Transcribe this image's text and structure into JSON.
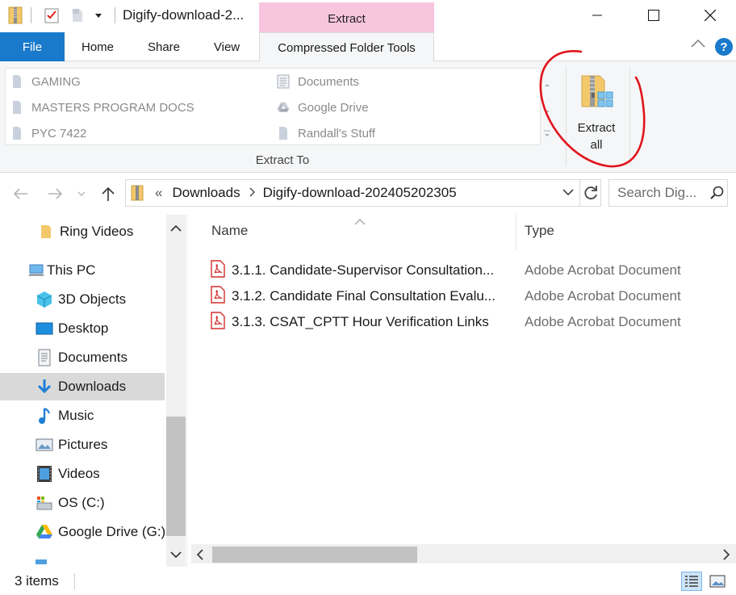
{
  "window": {
    "title": "Digify-download-2...",
    "context_tab_header": "Extract",
    "minimize_label": "",
    "maximize_label": "",
    "close_label": ""
  },
  "ribbon_tabs": [
    {
      "label": "File"
    },
    {
      "label": "Home"
    },
    {
      "label": "Share"
    },
    {
      "label": "View"
    },
    {
      "label": "Compressed Folder Tools"
    }
  ],
  "ribbon": {
    "extract_to_items": [
      {
        "label": "GAMING",
        "icon": "folder-icon"
      },
      {
        "label": "MASTERS PROGRAM DOCS",
        "icon": "folder-icon"
      },
      {
        "label": "PYC 7422",
        "icon": "folder-icon"
      },
      {
        "label": "Documents",
        "icon": "documents-icon"
      },
      {
        "label": "Google Drive",
        "icon": "google-drive-icon"
      },
      {
        "label": "Randall's Stuff",
        "icon": "folder-icon"
      }
    ],
    "group_label": "Extract To",
    "extract_all_line1": "Extract",
    "extract_all_line2": "all"
  },
  "address": {
    "overflow": "«",
    "breadcrumb": [
      "Downloads",
      "Digify-download-202405202305"
    ],
    "search_placeholder": "Search Dig..."
  },
  "nav_pane": {
    "items": [
      {
        "label": "Ring Videos",
        "icon": "folder-icon"
      },
      {
        "label": "This PC",
        "icon": "this-pc-icon"
      },
      {
        "label": "3D Objects",
        "icon": "3d-objects-icon"
      },
      {
        "label": "Desktop",
        "icon": "desktop-icon"
      },
      {
        "label": "Documents",
        "icon": "documents-icon"
      },
      {
        "label": "Downloads",
        "icon": "downloads-icon",
        "selected": true
      },
      {
        "label": "Music",
        "icon": "music-icon"
      },
      {
        "label": "Pictures",
        "icon": "pictures-icon"
      },
      {
        "label": "Videos",
        "icon": "videos-icon"
      },
      {
        "label": "OS (C:)",
        "icon": "drive-icon"
      },
      {
        "label": "Google Drive (G:)",
        "icon": "google-drive-icon"
      }
    ]
  },
  "file_list": {
    "columns": [
      "Name",
      "Type"
    ],
    "rows": [
      {
        "name": "3.1.1. Candidate-Supervisor Consultation...",
        "type": "Adobe Acrobat Document"
      },
      {
        "name": "3.1.2. Candidate Final Consultation Evalu...",
        "type": "Adobe Acrobat Document"
      },
      {
        "name": "3.1.3. CSAT_CPTT Hour Verification Links",
        "type": "Adobe Acrobat Document"
      }
    ]
  },
  "status": {
    "item_count": "3 items"
  },
  "colors": {
    "accent": "#1979ca",
    "context_tab": "#f8c5de",
    "annotation": "#e0141c"
  }
}
